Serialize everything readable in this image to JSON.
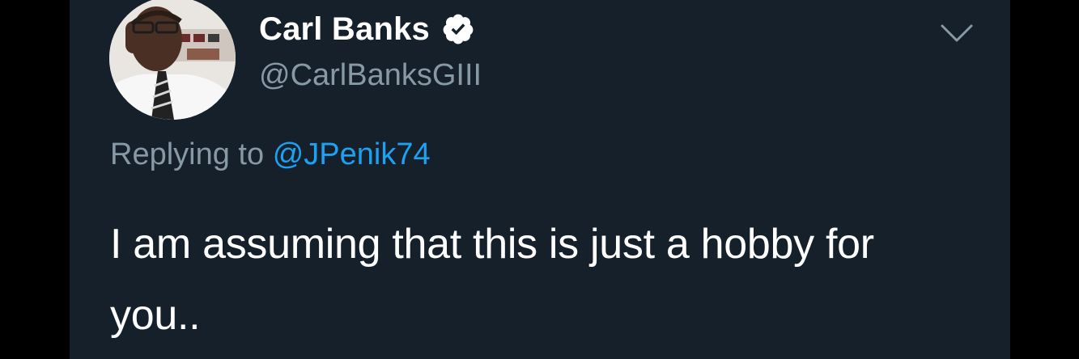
{
  "tweet": {
    "author": {
      "display_name": "Carl Banks",
      "handle": "@CarlBanksGIII",
      "verified": true,
      "avatar_icon": "profile-photo"
    },
    "reply_context": {
      "prefix": "Replying to",
      "handle": "@JPenik74"
    },
    "text": "I am assuming that this is just a hobby for you..",
    "menu_icon": "chevron-down-icon"
  },
  "colors": {
    "card_background": "#15202b",
    "outer_background": "#000000",
    "primary_text": "#ffffff",
    "secondary_text": "#8899a6",
    "link": "#1da1f2"
  }
}
